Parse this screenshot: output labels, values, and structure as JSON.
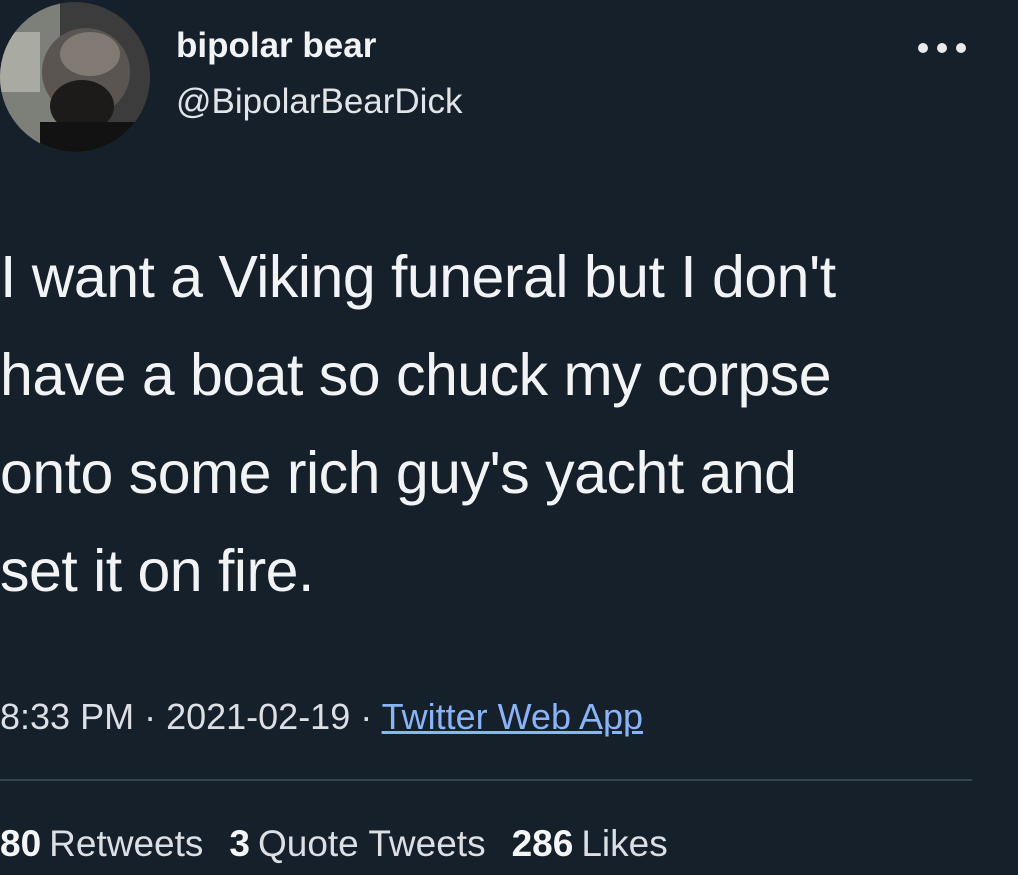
{
  "user": {
    "display_name": "bipolar bear",
    "handle": "@BipolarBearDick",
    "avatar_icon": "profile-photo"
  },
  "menu": {
    "icon": "more-options-icon"
  },
  "tweet": {
    "lines": [
      "I want a Viking funeral but I don't",
      "have a boat so chuck my corpse",
      "onto some rich guy's yacht and",
      "set it on fire."
    ]
  },
  "meta": {
    "time": "8:33 PM",
    "separator": " · ",
    "date": "2021-02-19",
    "source": "Twitter Web App"
  },
  "stats": {
    "retweets_count": "80",
    "retweets_label": "Retweets",
    "quotes_count": "3",
    "quotes_label": "Quote Tweets",
    "likes_count": "286",
    "likes_label": "Likes"
  },
  "colors": {
    "background": "#15202b",
    "link": "#8ab4f8",
    "text": "#f2f3f5"
  }
}
